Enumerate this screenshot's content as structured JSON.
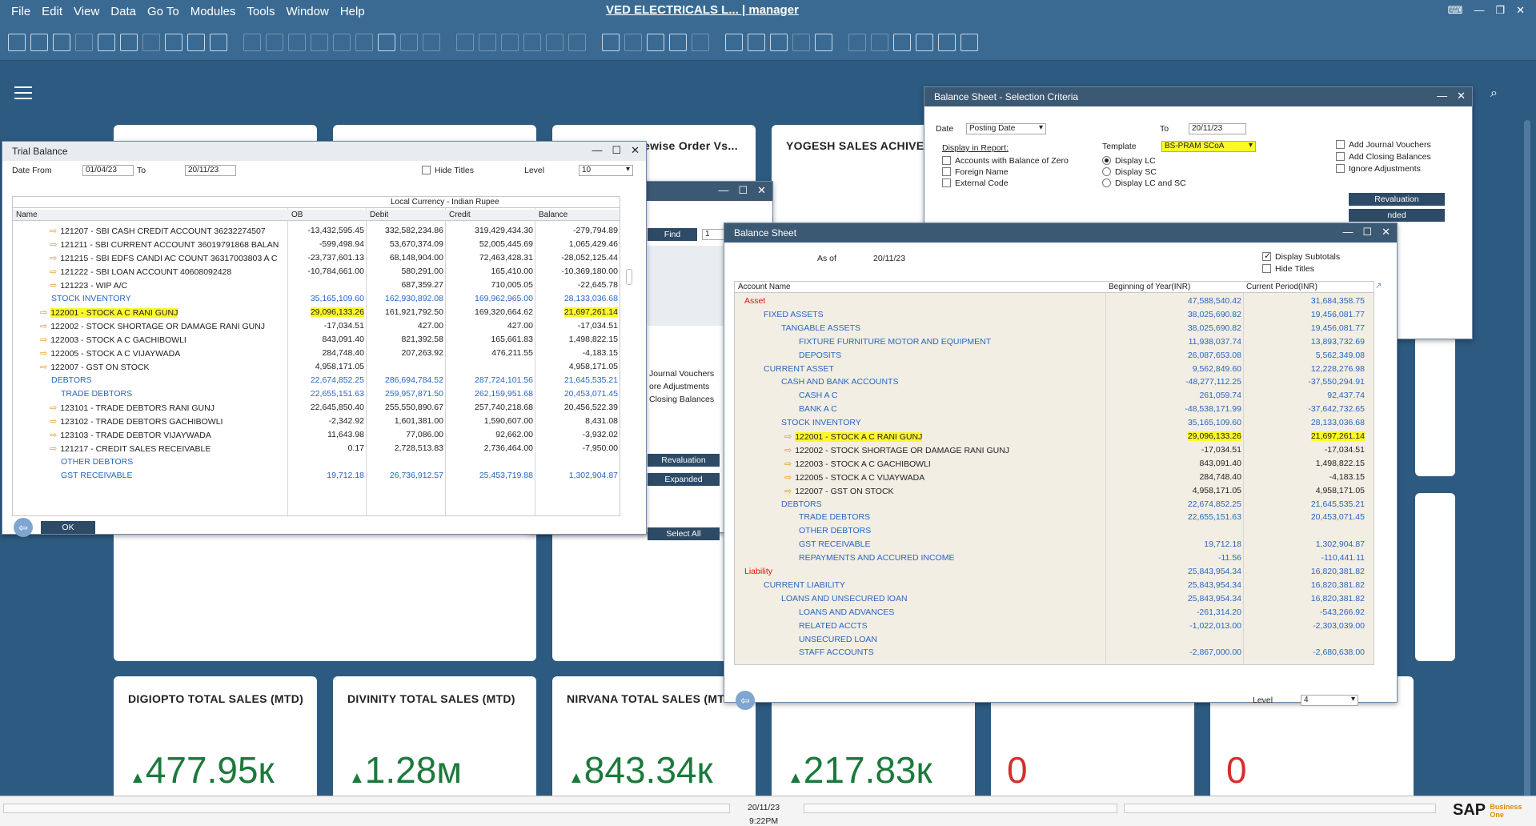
{
  "app": {
    "title": "VED ELECTRICALS L... | manager",
    "menu": [
      "File",
      "Edit",
      "View",
      "Data",
      "Go To",
      "Modules",
      "Tools",
      "Window",
      "Help"
    ]
  },
  "tiles": {
    "hidden_title": "ewise Order Vs...",
    "yogesh": "YOGESH SALES ACHIVE",
    "digiopto": "DIGIOPTO TOTAL SALES (MTD)",
    "digiopto_value": "477.95к",
    "divinity": "DIVINITY TOTAL SALES (MTD)",
    "divinity_value": "1.28м",
    "nirvana": "NIRVANA TOTAL SALES (MTD",
    "nirvana_value": "843.34к",
    "t4_value": "217.83к",
    "t5_value": "0",
    "t6_value": "0",
    "up_arrow": "▲"
  },
  "trial_balance": {
    "title": "Trial Balance",
    "date_from_label": "Date From",
    "date_from": "01/04/23",
    "to_label": "To",
    "date_to": "20/11/23",
    "hide_titles": "Hide Titles",
    "level_label": "Level",
    "level": "10",
    "currency_header": "Local Currency - Indian Rupee",
    "columns": [
      "Name",
      "OB",
      "Debit",
      "Credit",
      "Balance"
    ],
    "rows": [
      {
        "name": "121207 - SBI CASH CREDIT ACCOUNT 36232274507",
        "ob": "-13,432,595.45",
        "debit": "332,582,234.86",
        "credit": "319,429,434.30",
        "balance": "-279,794.89"
      },
      {
        "name": "121211 - SBI CURRENT ACCOUNT 36019791868  BALAN",
        "ob": "-599,498.94",
        "debit": "53,670,374.09",
        "credit": "52,005,445.69",
        "balance": "1,065,429.46"
      },
      {
        "name": "121215 - SBI EDFS CANDI AC COUNT 36317003803 A C",
        "ob": "-23,737,601.13",
        "debit": "68,148,904.00",
        "credit": "72,463,428.31",
        "balance": "-28,052,125.44"
      },
      {
        "name": "121222 - SBI LOAN ACCOUNT 40608092428",
        "ob": "-10,784,661.00",
        "debit": "580,291.00",
        "credit": "165,410.00",
        "balance": "-10,369,180.00"
      },
      {
        "name": "121223 - WIP A/C",
        "ob": "",
        "debit": "687,359.27",
        "credit": "710,005.05",
        "balance": "-22,645.78"
      },
      {
        "name": "STOCK  INVENTORY",
        "ob": "35,165,109.60",
        "debit": "162,930,892.08",
        "credit": "169,962,965.00",
        "balance": "28,133,036.68"
      },
      {
        "name": "122001 - STOCK A C RANI GUNJ",
        "ob": "29,096,133.26",
        "debit": "161,921,792.50",
        "credit": "169,320,664.62",
        "balance": "21,697,261.14"
      },
      {
        "name": "122002 - STOCK SHORTAGE OR DAMAGE RANI GUNJ",
        "ob": "-17,034.51",
        "debit": "427.00",
        "credit": "427.00",
        "balance": "-17,034.51"
      },
      {
        "name": "122003 - STOCK A C GACHIBOWLI",
        "ob": "843,091.40",
        "debit": "821,392.58",
        "credit": "165,661.83",
        "balance": "1,498,822.15"
      },
      {
        "name": "122005 - STOCK A C VIJAYWADA",
        "ob": "284,748.40",
        "debit": "207,263.92",
        "credit": "476,211.55",
        "balance": "-4,183.15"
      },
      {
        "name": "122007 - GST ON STOCK",
        "ob": "4,958,171.05",
        "debit": "",
        "credit": "",
        "balance": "4,958,171.05"
      },
      {
        "name": "DEBTORS",
        "ob": "22,674,852.25",
        "debit": "286,694,784.52",
        "credit": "287,724,101.56",
        "balance": "21,645,535.21"
      },
      {
        "name": "TRADE DEBTORS",
        "ob": "22,655,151.63",
        "debit": "259,957,871.50",
        "credit": "262,159,951.68",
        "balance": "20,453,071.45"
      },
      {
        "name": "123101 - TRADE DEBTORS RANI GUNJ",
        "ob": "22,645,850.40",
        "debit": "255,550,890.67",
        "credit": "257,740,218.68",
        "balance": "20,456,522.39"
      },
      {
        "name": "123102 - TRADE DEBTORS GACHIBOWLI",
        "ob": "-2,342.92",
        "debit": "1,601,381.00",
        "credit": "1,590,607.00",
        "balance": "8,431.08"
      },
      {
        "name": "123103 - TRADE DEBTOR VIJAYWADA",
        "ob": "11,643.98",
        "debit": "77,086.00",
        "credit": "92,662.00",
        "balance": "-3,932.02"
      },
      {
        "name": "121217 - CREDIT SALES RECEIVABLE",
        "ob": "0.17",
        "debit": "2,728,513.83",
        "credit": "2,736,464.00",
        "balance": "-7,950.00"
      },
      {
        "name": "OTHER DEBTORS",
        "ob": "",
        "debit": "",
        "credit": "",
        "balance": ""
      },
      {
        "name": "GST RECEIVABLE",
        "ob": "19,712.18",
        "debit": "26,736,912.57",
        "credit": "25,453,719.88",
        "balance": "1,302,904.87"
      }
    ],
    "ok_label": "OK"
  },
  "middle_window": {
    "find_label": "Find",
    "find_value": "1",
    "opt1": "Journal Vouchers",
    "opt2": "ore Adjustments",
    "opt3": "Closing Balances",
    "revaluation": "Revaluation",
    "expanded": "Expanded",
    "select_all": "Select All"
  },
  "bs_criteria": {
    "title": "Balance Sheet - Selection Criteria",
    "date_label": "Date",
    "date_type": "Posting Date",
    "to_label": "To",
    "to_date": "20/11/23",
    "display_in_report": "Display in Report:",
    "template_label": "Template",
    "template": "BS-PRAM SCoA",
    "accounts_zero": "Accounts with Balance of Zero",
    "foreign_name": "Foreign Name",
    "external_code": "External Code",
    "display_lc": "Display LC",
    "display_sc": "Display SC",
    "display_lc_sc": "Display LC and SC",
    "add_jv": "Add Journal Vouchers",
    "add_closing": "Add Closing Balances",
    "ignore_adj": "Ignore Adjustments",
    "revaluation": "Revaluation",
    "expanded": "nded"
  },
  "balance_sheet": {
    "title": "Balance Sheet",
    "as_of_label": "As of",
    "as_of": "20/11/23",
    "display_subtotals": "Display Subtotals",
    "hide_titles": "Hide Titles",
    "columns": [
      "Account Name",
      "Beginning of Year(INR)",
      "Current Period(INR)"
    ],
    "rows": [
      {
        "name": "Asset",
        "boy": "47,588,540.42",
        "cur": "31,684,358.75"
      },
      {
        "name": "FIXED ASSETS",
        "boy": "38,025,690.82",
        "cur": "19,456,081.77"
      },
      {
        "name": "TANGABLE ASSETS",
        "boy": "38,025,690.82",
        "cur": "19,456,081.77"
      },
      {
        "name": "FIXTURE FURNITURE MOTOR AND EQUIPMENT",
        "boy": "11,938,037.74",
        "cur": "13,893,732.69"
      },
      {
        "name": "DEPOSITS",
        "boy": "26,087,653.08",
        "cur": "5,562,349.08"
      },
      {
        "name": "CURRENT ASSET",
        "boy": "9,562,849.60",
        "cur": "12,228,276.98"
      },
      {
        "name": "CASH AND BANK ACCOUNTS",
        "boy": "-48,277,112.25",
        "cur": "-37,550,294.91"
      },
      {
        "name": "CASH A C",
        "boy": "261,059.74",
        "cur": "92,437.74"
      },
      {
        "name": "BANK A C",
        "boy": "-48,538,171.99",
        "cur": "-37,642,732.65"
      },
      {
        "name": "STOCK  INVENTORY",
        "boy": "35,165,109.60",
        "cur": "28,133,036.68"
      },
      {
        "name": "122001 - STOCK A C RANI GUNJ",
        "boy": "29,096,133.26",
        "cur": "21,697,261.14"
      },
      {
        "name": "122002 - STOCK SHORTAGE OR DAMAGE RANI GUNJ",
        "boy": "-17,034.51",
        "cur": "-17,034.51"
      },
      {
        "name": "122003 - STOCK A C GACHIBOWLI",
        "boy": "843,091.40",
        "cur": "1,498,822.15"
      },
      {
        "name": "122005 - STOCK A C VIJAYWADA",
        "boy": "284,748.40",
        "cur": "-4,183.15"
      },
      {
        "name": "122007 - GST ON STOCK",
        "boy": "4,958,171.05",
        "cur": "4,958,171.05"
      },
      {
        "name": "DEBTORS",
        "boy": "22,674,852.25",
        "cur": "21,645,535.21"
      },
      {
        "name": "TRADE DEBTORS",
        "boy": "22,655,151.63",
        "cur": "20,453,071.45"
      },
      {
        "name": "OTHER DEBTORS",
        "boy": "",
        "cur": ""
      },
      {
        "name": "GST RECEIVABLE",
        "boy": "19,712.18",
        "cur": "1,302,904.87"
      },
      {
        "name": "REPAYMENTS AND ACCURED INCOME",
        "boy": "-11.56",
        "cur": "-110,441.11"
      },
      {
        "name": "Liability",
        "boy": "25,843,954.34",
        "cur": "16,820,381.82"
      },
      {
        "name": "CURRENT LIABILITY",
        "boy": "25,843,954.34",
        "cur": "16,820,381.82"
      },
      {
        "name": "LOANS AND UNSECURED lOAN",
        "boy": "25,843,954.34",
        "cur": "16,820,381.82"
      },
      {
        "name": "LOANS AND ADVANCES",
        "boy": "-261,314.20",
        "cur": "-543,266.92"
      },
      {
        "name": "RELATED ACCTS",
        "boy": "-1,022,013.00",
        "cur": "-2,303,039.00"
      },
      {
        "name": "UNSECURED LOAN",
        "boy": "",
        "cur": ""
      },
      {
        "name": "STAFF ACCOUNTS",
        "boy": "-2,867,000.00",
        "cur": "-2,680,638.00"
      }
    ],
    "level_label": "Level",
    "level": "4"
  },
  "status": {
    "date": "20/11/23",
    "time": "9:22PM",
    "logo": "SAP",
    "logo_small1": "Business",
    "logo_small2": "One"
  }
}
